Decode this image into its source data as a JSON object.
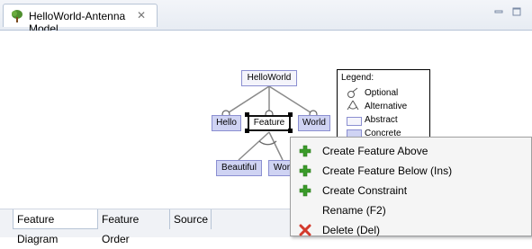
{
  "editor": {
    "tab_title": "HelloWorld-Antenna Model",
    "tab_icon": "tree-icon",
    "close_icon": "close-icon"
  },
  "diagram": {
    "features": {
      "root": "HelloWorld",
      "hello": "Hello",
      "feature": "Feature",
      "world": "World",
      "beautiful": "Beautiful",
      "wonderful": "Wor"
    },
    "legend": {
      "title": "Legend:",
      "optional": "Optional",
      "alternative": "Alternative",
      "abstract": "Abstract",
      "concrete": "Concrete"
    }
  },
  "bottom_tabs": {
    "feature_diagram": "Feature Diagram",
    "feature_order": "Feature Order",
    "source": "Source"
  },
  "context_menu": {
    "items": [
      {
        "label": "Create Feature Above",
        "icon": "green-plus-icon"
      },
      {
        "label": "Create Feature Below (Ins)",
        "icon": "green-plus-icon"
      },
      {
        "label": "Create Constraint",
        "icon": "green-plus-icon"
      },
      {
        "label": "Rename (F2)",
        "icon": ""
      },
      {
        "label": "Delete (Del)",
        "icon": "red-x-icon"
      }
    ]
  },
  "colors": {
    "concrete": "#cfd3f3",
    "abstract": "#f4f4fb",
    "feature_border": "#8b8fd1",
    "plus_green": "#3a9a2a",
    "delete_red": "#d33a2c"
  }
}
